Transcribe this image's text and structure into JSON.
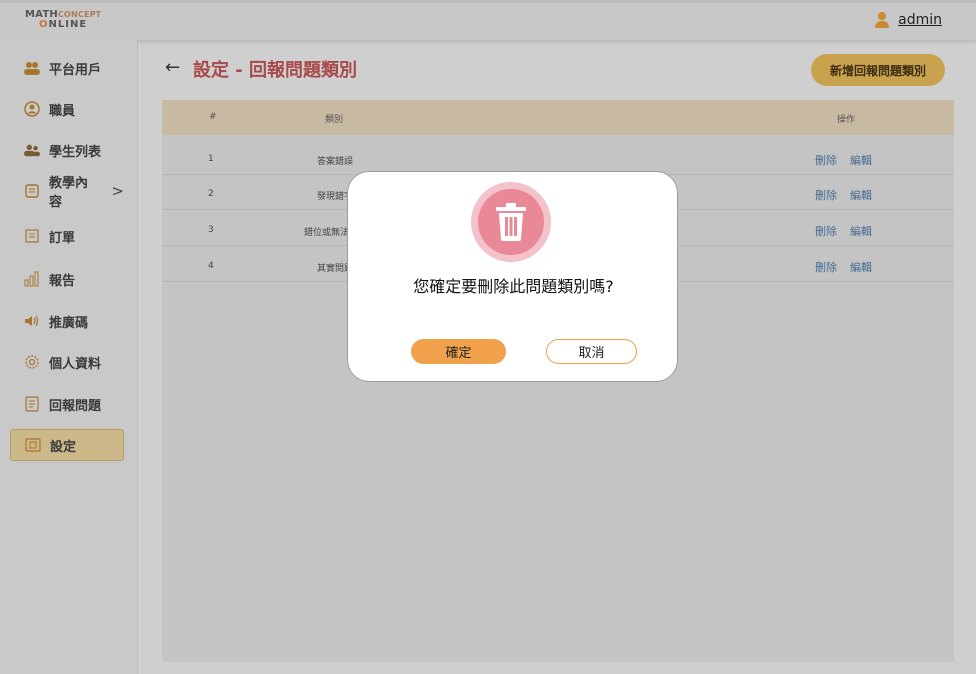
{
  "app": {
    "logo_line1_a": "MATH",
    "logo_line1_b": "CONCEPT",
    "logo_line2_a": "O",
    "logo_line2_b": "NLINE"
  },
  "header": {
    "user_name": "admin",
    "user_icon": "user-icon"
  },
  "sidebar": {
    "items": [
      {
        "label": "平台用戶",
        "icon": "users-icon"
      },
      {
        "label": "職員",
        "icon": "staff-icon"
      },
      {
        "label": "學生列表",
        "icon": "students-icon"
      },
      {
        "label": "教學內容",
        "icon": "book-icon",
        "arrow": ">"
      },
      {
        "label": "訂單",
        "icon": "order-icon"
      },
      {
        "label": "報告",
        "icon": "chart-icon"
      },
      {
        "label": "推廣碼",
        "icon": "megaphone-icon"
      },
      {
        "label": "個人資料",
        "icon": "gear-icon"
      },
      {
        "label": "回報問題",
        "icon": "report-icon"
      },
      {
        "label": "設定",
        "icon": "settings-icon",
        "active": true
      }
    ]
  },
  "main": {
    "back_arrow": "←",
    "title": "設定 - 回報問題類別",
    "add_button": "新增回報問題類別"
  },
  "table": {
    "headers": {
      "index": "#",
      "category": "類別",
      "actions": "操作"
    },
    "rows": [
      {
        "index": "1",
        "category": "答案錯誤"
      },
      {
        "index": "2",
        "category": "發現錯字"
      },
      {
        "index": "3",
        "category": "錯位或無法"
      },
      {
        "index": "4",
        "category": "其實問題"
      }
    ],
    "delete_label": "刪除",
    "edit_label": "編輯"
  },
  "modal": {
    "icon": "trash-icon",
    "message": "您確定要刪除此問題類別嗎?",
    "confirm": "確定",
    "cancel": "取消"
  },
  "colors": {
    "accent_orange": "#f1a14c",
    "title_red": "#a8494b",
    "trash_pink": "#e98896",
    "link_blue": "#466b94"
  }
}
